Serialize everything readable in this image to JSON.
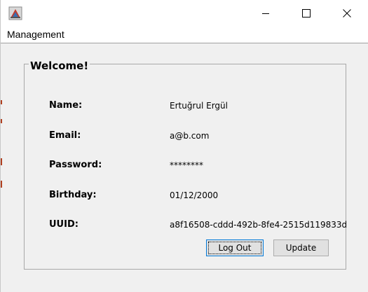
{
  "window": {
    "menu": [
      "Management"
    ]
  },
  "panel": {
    "title": "Welcome!",
    "fields": [
      {
        "label": "Name:",
        "value": "Ertuğrul Ergül"
      },
      {
        "label": "Email:",
        "value": "a@b.com"
      },
      {
        "label": "Password:",
        "value": "********"
      },
      {
        "label": "Birthday:",
        "value": "01/12/2000"
      },
      {
        "label": "UUID:",
        "value": "a8f16508-cddd-492b-8fe4-2515d119833d"
      }
    ]
  },
  "buttons": {
    "logout": "Log Out",
    "update": "Update"
  },
  "icons": {
    "app": "java-app-icon",
    "minimize": "minimize-icon",
    "maximize": "maximize-icon",
    "close": "close-icon"
  },
  "colors": {
    "window_bg": "#f0f0f0",
    "titlebar_bg": "#ffffff",
    "button_bg": "#e1e1e1",
    "focus_border": "#0078d7"
  }
}
